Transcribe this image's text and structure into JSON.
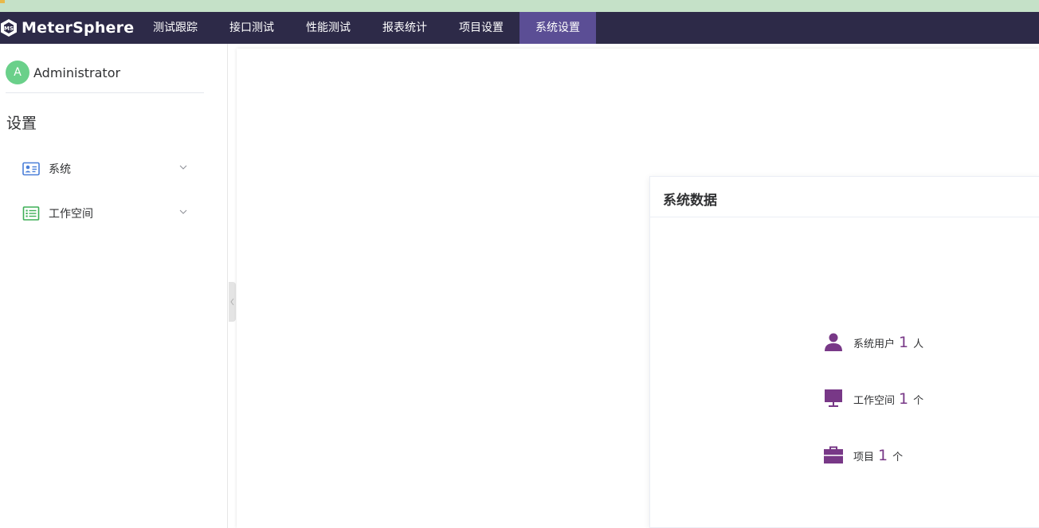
{
  "app": {
    "brand": "MeterSphere"
  },
  "nav": {
    "items": [
      {
        "label": "测试跟踪"
      },
      {
        "label": "接口测试"
      },
      {
        "label": "性能测试"
      },
      {
        "label": "报表统计"
      },
      {
        "label": "项目设置"
      },
      {
        "label": "系统设置"
      }
    ],
    "active": "系统设置"
  },
  "sidebar": {
    "avatar_letter": "A",
    "username": "Administrator",
    "settings_title": "设置",
    "menu": [
      {
        "label": "系统",
        "icon": "id-card-icon"
      },
      {
        "label": "工作空间",
        "icon": "list-icon"
      }
    ]
  },
  "card": {
    "title": "系统数据",
    "stats": [
      {
        "icon": "user-icon",
        "label": "系统用户",
        "value": "1",
        "unit": "人"
      },
      {
        "icon": "monitor-icon",
        "label": "工作空间",
        "value": "1",
        "unit": "个"
      },
      {
        "icon": "briefcase-icon",
        "label": "项目",
        "value": "1",
        "unit": "个"
      }
    ]
  },
  "colors": {
    "navbar_bg": "#2d2a48",
    "nav_active": "#5b4e95",
    "accent_purple": "#783887",
    "avatar_green": "#6ad08a"
  }
}
